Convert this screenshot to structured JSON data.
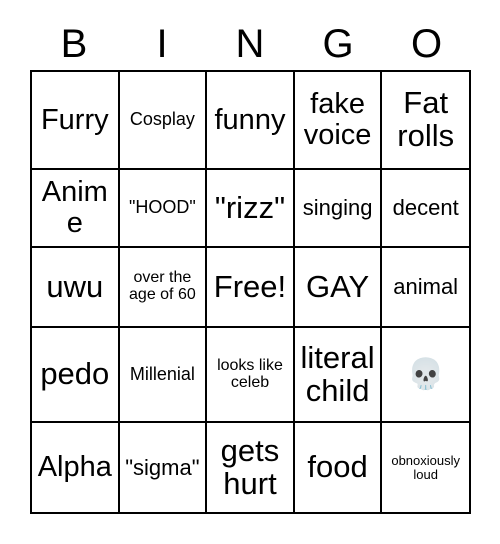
{
  "card": {
    "title": "BINGO",
    "header_letters": [
      "B",
      "I",
      "N",
      "G",
      "O"
    ],
    "columns": 5,
    "rows": 5,
    "background_color": "#ffffff",
    "border_color": "#000000",
    "text_color": "#000000"
  },
  "cells": [
    [
      {
        "text": "Furry",
        "size": "lg"
      },
      {
        "text": "Cosplay",
        "size": "sm"
      },
      {
        "text": "funny",
        "size": "lg"
      },
      {
        "text": "fake voice",
        "size": "lg"
      },
      {
        "text": "Fat rolls",
        "size": "xl"
      }
    ],
    [
      {
        "text": "Anime",
        "size": "lg"
      },
      {
        "text": "\"HOOD\"",
        "size": "sm"
      },
      {
        "text": "\"rizz\"",
        "size": "xl"
      },
      {
        "text": "singing",
        "size": "md"
      },
      {
        "text": "decent",
        "size": "md"
      }
    ],
    [
      {
        "text": "uwu",
        "size": "xl"
      },
      {
        "text": "over the age of 60",
        "size": "xs"
      },
      {
        "text": "Free!",
        "size": "xl"
      },
      {
        "text": "GAY",
        "size": "xl"
      },
      {
        "text": "animal",
        "size": "md"
      }
    ],
    [
      {
        "text": "pedo",
        "size": "xl"
      },
      {
        "text": "Millenial",
        "size": "sm"
      },
      {
        "text": "looks like celeb",
        "size": "xs"
      },
      {
        "text": "literal child",
        "size": "xl"
      },
      {
        "text": "💀",
        "size": "emoji",
        "icon": "skull-emoji"
      }
    ],
    [
      {
        "text": "Alpha",
        "size": "lg"
      },
      {
        "text": "\"sigma\"",
        "size": "md"
      },
      {
        "text": "gets hurt",
        "size": "xl"
      },
      {
        "text": "food",
        "size": "xl"
      },
      {
        "text": "obnoxiously loud",
        "size": "xxs"
      }
    ]
  ]
}
